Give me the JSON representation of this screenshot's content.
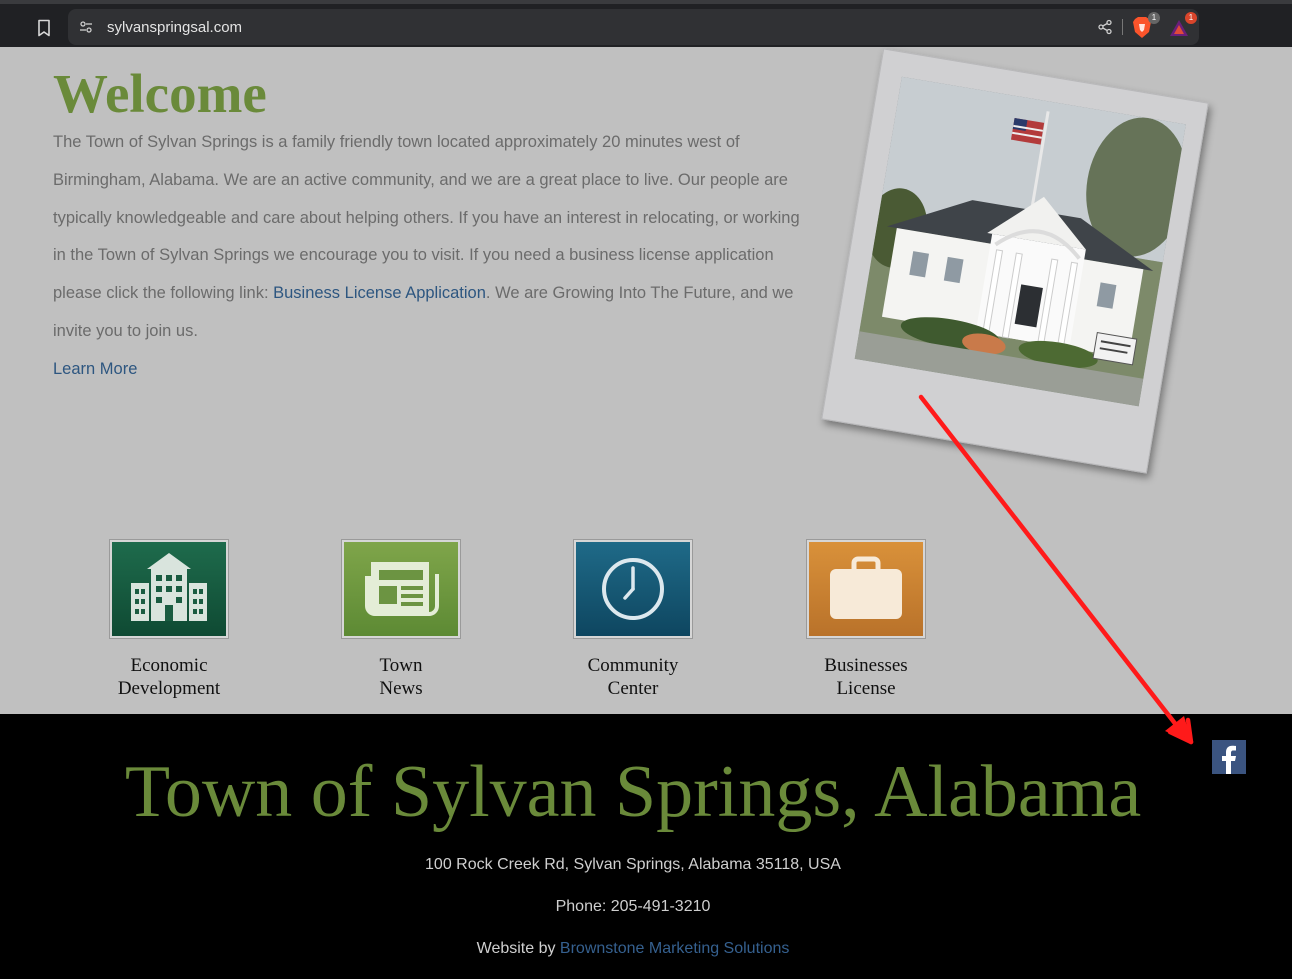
{
  "browser": {
    "url": "sylvanspringsal.com",
    "brave_badge": "1",
    "rewards_badge": "1",
    "accent_color": "#fb542b"
  },
  "welcome": {
    "title": "Welcome",
    "body_before_link": "The Town of Sylvan Springs is a family friendly town located approximately 20 minutes west of Birmingham, Alabama. We are an active community, and we are a great place to live. Our people are typically knowledgeable and care about helping others. If you have an interest in relocating, or working in the Town of Sylvan Springs we encourage you to visit. If you need a business license application please click the following link: ",
    "link_text": "Business License Application",
    "body_after_link": ". We are Growing Into The Future, and we invite you to join us.",
    "learn_more": "Learn More",
    "title_color": "#6a8a3a",
    "link_color": "#2d5680"
  },
  "quick_links": [
    {
      "line1": "Economic",
      "line2": "Development",
      "icon": "building-icon",
      "color_top": "#1e6b4c",
      "color_bottom": "#0f4a33"
    },
    {
      "line1": "Town",
      "line2": "News",
      "icon": "newspaper-icon",
      "color_top": "#7fa54a",
      "color_bottom": "#5d8a34"
    },
    {
      "line1": "Community",
      "line2": "Center",
      "icon": "clock-icon",
      "color_top": "#1f6a88",
      "color_bottom": "#0e4660"
    },
    {
      "line1": "Businesses",
      "line2": "License",
      "icon": "briefcase-icon",
      "color_top": "#d9913a",
      "color_bottom": "#b9722a"
    }
  ],
  "footer": {
    "title": "Town of Sylvan Springs, Alabama",
    "address": "100 Rock Creek Rd, Sylvan Springs, Alabama 35118, USA",
    "phone": "Phone: 205-491-3210",
    "credit_prefix": "Website by ",
    "credit_link": "Brownstone Marketing Solutions",
    "facebook_icon": "facebook-icon",
    "facebook_color": "#3b5480"
  },
  "annotation": {
    "type": "arrow",
    "color": "#ff1a1a"
  }
}
